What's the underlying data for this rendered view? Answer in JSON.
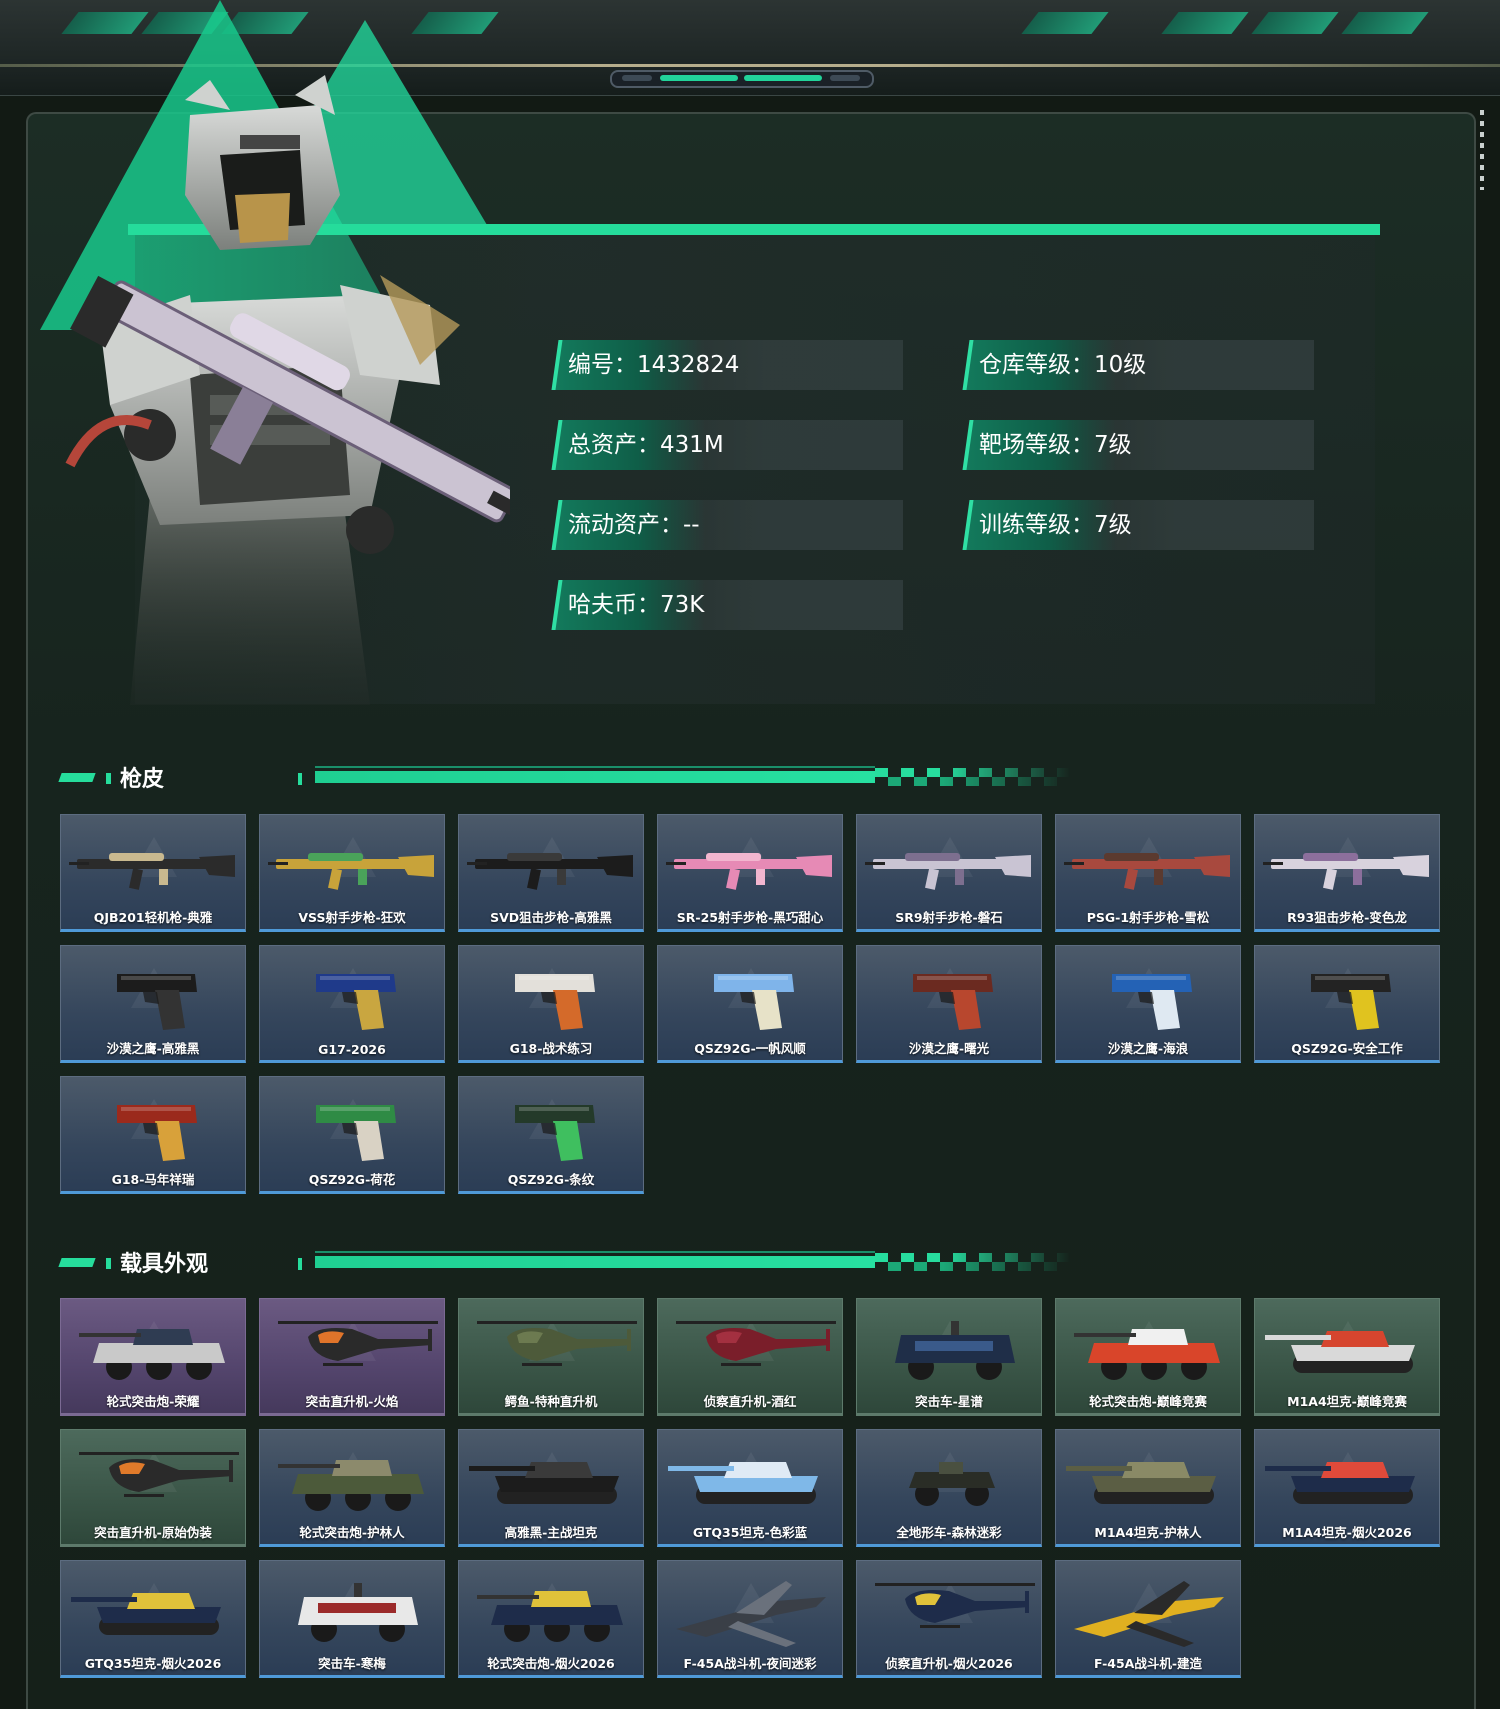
{
  "profile": {
    "stats_left": [
      {
        "label": "编号",
        "value": "1432824"
      },
      {
        "label": "总资产",
        "value": "431M"
      },
      {
        "label": "流动资产",
        "value": "--"
      },
      {
        "label": "哈夫币",
        "value": "73K"
      }
    ],
    "stats_right": [
      {
        "label": "仓库等级",
        "value": "10级"
      },
      {
        "label": "靶场等级",
        "value": "7级"
      },
      {
        "label": "训练等级",
        "value": "7级"
      }
    ],
    "separator": "："
  },
  "gun_skins": {
    "title": "枪皮",
    "items": [
      {
        "name": "QJB201轻机枪-典雅",
        "kind": "rifle",
        "rarity": "blue",
        "c1": "#2b2b2b",
        "c2": "#c9b98f"
      },
      {
        "name": "VSS射手步枪-狂欢",
        "kind": "rifle",
        "rarity": "blue",
        "c1": "#c8a33a",
        "c2": "#4aa35a"
      },
      {
        "name": "SVD狙击步枪-高雅黑",
        "kind": "rifle",
        "rarity": "blue",
        "c1": "#1c1c1c",
        "c2": "#3a3a3a"
      },
      {
        "name": "SR-25射手步枪-黑巧甜心",
        "kind": "rifle",
        "rarity": "blue",
        "c1": "#e68ab5",
        "c2": "#f2b6cf"
      },
      {
        "name": "SR9射手步枪-磐石",
        "kind": "rifle",
        "rarity": "blue",
        "c1": "#c9c4d3",
        "c2": "#7d6f8f"
      },
      {
        "name": "PSG-1射手步枪-雪松",
        "kind": "rifle",
        "rarity": "blue",
        "c1": "#a8493e",
        "c2": "#5b3a2f"
      },
      {
        "name": "R93狙击步枪-变色龙",
        "kind": "rifle",
        "rarity": "blue",
        "c1": "#d8d2dd",
        "c2": "#8c6f9c"
      },
      {
        "name": "沙漠之鹰-高雅黑",
        "kind": "pistol",
        "rarity": "blue",
        "c1": "#1c1c1c",
        "c2": "#333333"
      },
      {
        "name": "G17-2026",
        "kind": "pistol",
        "rarity": "blue",
        "c1": "#1f3a8a",
        "c2": "#c9a640"
      },
      {
        "name": "G18-战术练习",
        "kind": "pistol",
        "rarity": "blue",
        "c1": "#e3e0da",
        "c2": "#d46a2a"
      },
      {
        "name": "QSZ92G-一帆风顺",
        "kind": "pistol",
        "rarity": "blue",
        "c1": "#7fb4ea",
        "c2": "#e7e2c8"
      },
      {
        "name": "沙漠之鹰-曙光",
        "kind": "pistol",
        "rarity": "blue",
        "c1": "#6b2a20",
        "c2": "#b8472e"
      },
      {
        "name": "沙漠之鹰-海浪",
        "kind": "pistol",
        "rarity": "blue",
        "c1": "#2462b5",
        "c2": "#dfe9f2"
      },
      {
        "name": "QSZ92G-安全工作",
        "kind": "pistol",
        "rarity": "blue",
        "c1": "#232323",
        "c2": "#e0c31f"
      },
      {
        "name": "G18-马年祥瑞",
        "kind": "pistol",
        "rarity": "blue",
        "c1": "#9b2a1c",
        "c2": "#d8a13a"
      },
      {
        "name": "QSZ92G-荷花",
        "kind": "pistol",
        "rarity": "blue",
        "c1": "#2f8b45",
        "c2": "#d9d2c4"
      },
      {
        "name": "QSZ92G-条纹",
        "kind": "pistol",
        "rarity": "blue",
        "c1": "#243a2a",
        "c2": "#3fbf5f"
      }
    ]
  },
  "vehicle_skins": {
    "title": "载具外观",
    "items": [
      {
        "name": "轮式突击炮-荣耀",
        "kind": "wheeled",
        "rarity": "purple",
        "c1": "#c9c9c9",
        "c2": "#2f3c52"
      },
      {
        "name": "突击直升机-火焰",
        "kind": "heli",
        "rarity": "purple",
        "c1": "#2a2a2a",
        "c2": "#e0742a"
      },
      {
        "name": "鳄鱼-特种直升机",
        "kind": "heli",
        "rarity": "green",
        "c1": "#4d5a3a",
        "c2": "#6c7a50"
      },
      {
        "name": "侦察直升机-酒红",
        "kind": "heli",
        "rarity": "green",
        "c1": "#7a1e2a",
        "c2": "#a33040"
      },
      {
        "name": "突击车-星谱",
        "kind": "truck",
        "rarity": "green",
        "c1": "#1f2e48",
        "c2": "#3a5a8a"
      },
      {
        "name": "轮式突击炮-巅峰竞赛",
        "kind": "wheeled",
        "rarity": "green",
        "c1": "#d9452a",
        "c2": "#f0f0f0"
      },
      {
        "name": "M1A4坦克-巅峰竞赛",
        "kind": "tank",
        "rarity": "green",
        "c1": "#d9d9d9",
        "c2": "#d6452e"
      },
      {
        "name": "突击直升机-原始伪装",
        "kind": "heli",
        "rarity": "green",
        "c1": "#2a2a2a",
        "c2": "#e07a2a"
      },
      {
        "name": "轮式突击炮-护林人",
        "kind": "wheeled",
        "rarity": "blue",
        "c1": "#4c5a3a",
        "c2": "#8c8a6c"
      },
      {
        "name": "高雅黑-主战坦克",
        "kind": "tank",
        "rarity": "blue",
        "c1": "#1c1c1c",
        "c2": "#3a3a3a"
      },
      {
        "name": "GTQ35坦克-色彩蓝",
        "kind": "tank",
        "rarity": "blue",
        "c1": "#7fb8e8",
        "c2": "#dfeaf5"
      },
      {
        "name": "全地形车-森林迷彩",
        "kind": "atv",
        "rarity": "blue",
        "c1": "#2a2d26",
        "c2": "#4a5040"
      },
      {
        "name": "M1A4坦克-护林人",
        "kind": "tank",
        "rarity": "blue",
        "c1": "#5b5e44",
        "c2": "#8a8a66"
      },
      {
        "name": "M1A4坦克-烟火2026",
        "kind": "tank",
        "rarity": "blue",
        "c1": "#1e2c4a",
        "c2": "#e04a3a"
      },
      {
        "name": "GTQ35坦克-烟火2026",
        "kind": "tank",
        "rarity": "blue",
        "c1": "#1e2c4a",
        "c2": "#e0c23a"
      },
      {
        "name": "突击车-寒梅",
        "kind": "truck",
        "rarity": "blue",
        "c1": "#e8e8e8",
        "c2": "#9b2a2a"
      },
      {
        "name": "轮式突击炮-烟火2026",
        "kind": "wheeled",
        "rarity": "blue",
        "c1": "#1e2c4a",
        "c2": "#e0c23a"
      },
      {
        "name": "F-45A战斗机-夜间迷彩",
        "kind": "jet",
        "rarity": "blue",
        "c1": "#3a3f47",
        "c2": "#6a717c"
      },
      {
        "name": "侦察直升机-烟火2026",
        "kind": "heli",
        "rarity": "blue",
        "c1": "#1e2c4a",
        "c2": "#e0c23a"
      },
      {
        "name": "F-45A战斗机-建造",
        "kind": "jet",
        "rarity": "blue",
        "c1": "#e0b020",
        "c2": "#2a2a2a"
      }
    ]
  }
}
